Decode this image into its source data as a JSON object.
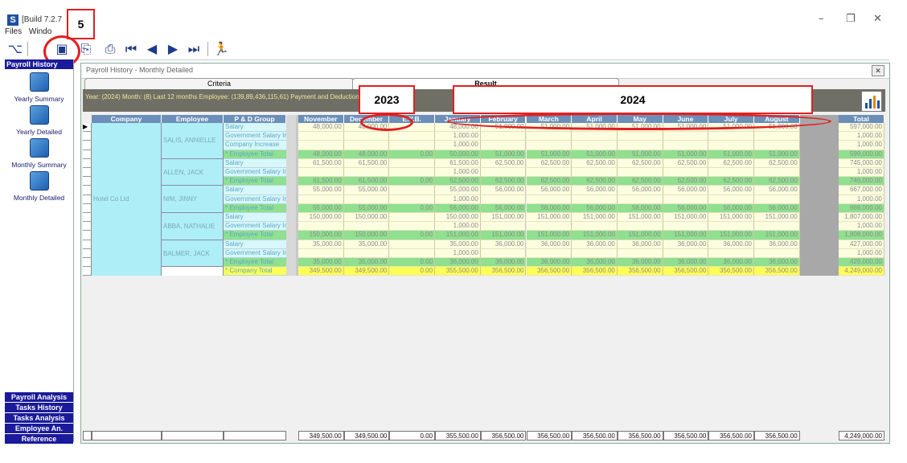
{
  "app": {
    "title": "[Build 7.2.7",
    "icon": "S"
  },
  "callouts": {
    "step": "5",
    "year_prev": "2023",
    "year_current": "2024"
  },
  "menu": [
    "Files",
    "Windo"
  ],
  "toolbar": {
    "icons": [
      "tree-icon",
      "history-icon",
      "preview-icon",
      "print-icon",
      "first-icon",
      "prev-icon",
      "next-icon",
      "last-icon",
      "run-icon"
    ]
  },
  "nav": {
    "header": "Payroll History",
    "items": [
      "Yearly Summary",
      "Yearly Detailed",
      "Monthly Summary",
      "Monthly Detailed"
    ],
    "bottom": [
      "Payroll Analysis",
      "Tasks History",
      "Tasks Analysis",
      "Employee An.",
      "Reference"
    ]
  },
  "panel": {
    "title": "Payroll History - Monthly Detailed",
    "tabs": [
      "Criteria",
      "Result"
    ],
    "summary": "Year: (2024) Month: (8) Last 12 months Employee: (139,89,436,115,61) Payment and Deduction: (2"
  },
  "grid": {
    "left_headers": [
      "Company",
      "Employee",
      "P & D Group"
    ],
    "month_headers": [
      "November",
      "December",
      "E.Y.B.",
      "January",
      "February",
      "March",
      "April",
      "May",
      "June",
      "July",
      "August"
    ],
    "total_header": "Total",
    "company": "Hotel Co Ltd",
    "rows": [
      {
        "emp": "SALIS, ANNIELLE",
        "pd": "Salary",
        "type": "s",
        "vals": [
          "48,000.00",
          "48,000.00",
          "",
          "48,000.00",
          "51,000.00",
          "51,000.00",
          "51,000.00",
          "51,000.00",
          "51,000.00",
          "51,000.00",
          "51,000.00"
        ],
        "total": "597,000.00"
      },
      {
        "emp": "",
        "pd": "Government Salary In.",
        "type": "s",
        "vals": [
          "",
          "",
          "",
          "1,000.00",
          "",
          "",
          "",
          "",
          "",
          "",
          ""
        ],
        "total": "1,000.00"
      },
      {
        "emp": "",
        "pd": "Company Increase",
        "type": "s",
        "vals": [
          "",
          "",
          "",
          "1,000.00",
          "",
          "",
          "",
          "",
          "",
          "",
          ""
        ],
        "total": "1,000.00"
      },
      {
        "emp": "",
        "pd": "* Employee Total",
        "type": "e",
        "vals": [
          "48,000.00",
          "48,000.00",
          "0.00",
          "50,000.00",
          "51,000.00",
          "51,000.00",
          "51,000.00",
          "51,000.00",
          "51,000.00",
          "51,000.00",
          "51,000.00"
        ],
        "total": "599,000.00"
      },
      {
        "emp": "ALLEN, JACK",
        "pd": "Salary",
        "type": "s",
        "vals": [
          "61,500.00",
          "61,500.00",
          "",
          "61,500.00",
          "62,500.00",
          "62,500.00",
          "62,500.00",
          "62,500.00",
          "62,500.00",
          "62,500.00",
          "62,500.00"
        ],
        "total": "745,000.00"
      },
      {
        "emp": "",
        "pd": "Government Salary In.",
        "type": "s",
        "vals": [
          "",
          "",
          "",
          "1,000.00",
          "",
          "",
          "",
          "",
          "",
          "",
          ""
        ],
        "total": "1,000.00"
      },
      {
        "emp": "",
        "pd": "* Employee Total",
        "type": "e",
        "vals": [
          "61,500.00",
          "61,500.00",
          "0.00",
          "62,500.00",
          "62,500.00",
          "62,500.00",
          "62,500.00",
          "62,500.00",
          "62,500.00",
          "62,500.00",
          "62,500.00"
        ],
        "total": "746,000.00"
      },
      {
        "emp": "NIM, JINNY",
        "pd": "Salary",
        "type": "s",
        "vals": [
          "55,000.00",
          "55,000.00",
          "",
          "55,000.00",
          "56,000.00",
          "56,000.00",
          "56,000.00",
          "56,000.00",
          "56,000.00",
          "56,000.00",
          "56,000.00"
        ],
        "total": "667,000.00"
      },
      {
        "emp": "",
        "pd": "Government Salary In.",
        "type": "s",
        "vals": [
          "",
          "",
          "",
          "1,000.00",
          "",
          "",
          "",
          "",
          "",
          "",
          ""
        ],
        "total": "1,000.00"
      },
      {
        "emp": "",
        "pd": "* Employee Total",
        "type": "e",
        "vals": [
          "55,000.00",
          "55,000.00",
          "0.00",
          "56,000.00",
          "56,000.00",
          "56,000.00",
          "56,000.00",
          "56,000.00",
          "56,000.00",
          "56,000.00",
          "56,000.00"
        ],
        "total": "668,000.00"
      },
      {
        "emp": "ABBA, NATHALIE",
        "pd": "Salary",
        "type": "s",
        "vals": [
          "150,000.00",
          "150,000.00",
          "",
          "150,000.00",
          "151,000.00",
          "151,000.00",
          "151,000.00",
          "151,000.00",
          "151,000.00",
          "151,000.00",
          "151,000.00"
        ],
        "total": "1,807,000.00"
      },
      {
        "emp": "",
        "pd": "Government Salary In.",
        "type": "s",
        "vals": [
          "",
          "",
          "",
          "1,000.00",
          "",
          "",
          "",
          "",
          "",
          "",
          ""
        ],
        "total": "1,000.00"
      },
      {
        "emp": "",
        "pd": "* Employee Total",
        "type": "e",
        "vals": [
          "150,000.00",
          "150,000.00",
          "0.00",
          "151,000.00",
          "151,000.00",
          "151,000.00",
          "151,000.00",
          "151,000.00",
          "151,000.00",
          "151,000.00",
          "151,000.00"
        ],
        "total": "1,808,000.00"
      },
      {
        "emp": "BALMER, JACK",
        "pd": "Salary",
        "type": "s",
        "vals": [
          "35,000.00",
          "35,000.00",
          "",
          "35,000.00",
          "36,000.00",
          "36,000.00",
          "36,000.00",
          "36,000.00",
          "36,000.00",
          "36,000.00",
          "36,000.00"
        ],
        "total": "427,000.00"
      },
      {
        "emp": "",
        "pd": "Government Salary In.",
        "type": "s",
        "vals": [
          "",
          "",
          "",
          "1,000.00",
          "",
          "",
          "",
          "",
          "",
          "",
          ""
        ],
        "total": "1,000.00"
      },
      {
        "emp": "",
        "pd": "* Employee Total",
        "type": "e",
        "vals": [
          "35,000.00",
          "35,000.00",
          "0.00",
          "36,000.00",
          "36,000.00",
          "36,000.00",
          "36,000.00",
          "36,000.00",
          "36,000.00",
          "36,000.00",
          "36,000.00"
        ],
        "total": "428,000.00"
      },
      {
        "emp": "",
        "pd": "* Company Total",
        "type": "c",
        "vals": [
          "349,500.00",
          "349,500.00",
          "0.00",
          "355,500.00",
          "356,500.00",
          "356,500.00",
          "356,500.00",
          "356,500.00",
          "356,500.00",
          "356,500.00",
          "356,500.00"
        ],
        "total": "4,249,000.00"
      }
    ],
    "footer": [
      "349,500.00",
      "349,500.00",
      "0.00",
      "355,500.00",
      "356,500.00",
      "356,500.00",
      "356,500.00",
      "356,500.00",
      "356,500.00",
      "356,500.00",
      "356,500.00"
    ],
    "footer_total": "4,249,000.00"
  },
  "colors": {
    "header": "#6b8fb8",
    "employee_total": "#8fe08f",
    "company_total": "#ffff55",
    "salary": "#fdfde0",
    "company_col": "#aeeef6",
    "pd_col": "#d7f7fa",
    "callout": "#e02020"
  }
}
